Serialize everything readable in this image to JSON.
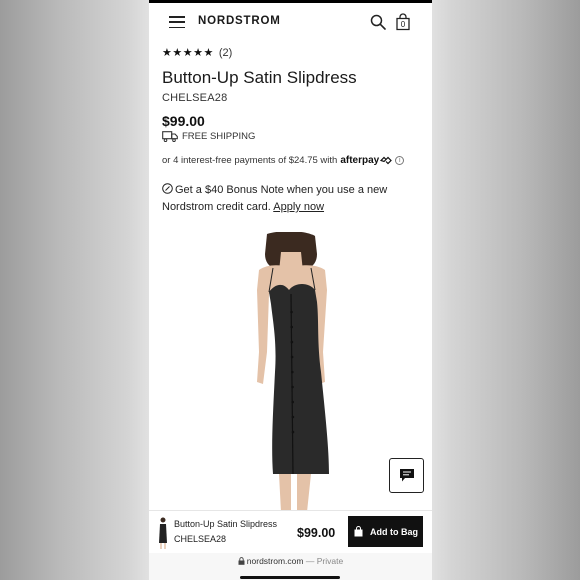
{
  "header": {
    "logo": "NORDSTROM",
    "bag_count": "0"
  },
  "icons": {
    "menu": "hamburger-menu-icon",
    "search": "search-icon",
    "bag": "shopping-bag-icon",
    "truck": "truck-icon",
    "info": "info-icon",
    "bonus": "nordstrom-note-icon",
    "chat": "chat-icon",
    "lock": "lock-icon"
  },
  "product": {
    "rating_stars": "★★★★★",
    "rating_count": "(2)",
    "rating_value": 5,
    "title": "Button-Up Satin Slipdress",
    "sku": "CHELSEA28",
    "price": "$99.00",
    "shipping": "FREE SHIPPING"
  },
  "afterpay": {
    "text": "or 4 interest-free payments of $24.75 with",
    "brand": "afterpay",
    "info": "i"
  },
  "bonus": {
    "text": "Get a $40 Bonus Note when you use a new Nordstrom credit card.",
    "link": "Apply now"
  },
  "sticky_bar": {
    "name": "Button-Up Satin Slipdress",
    "sku": "CHELSEA28",
    "price": "$99.00",
    "button": "Add to Bag"
  },
  "browser": {
    "domain": "nordstrom.com",
    "separator": "—",
    "mode": "Private"
  },
  "colors": {
    "primary": "#111111",
    "page_bg": "#ffffff",
    "outer_bg": "#e2e2e2"
  }
}
